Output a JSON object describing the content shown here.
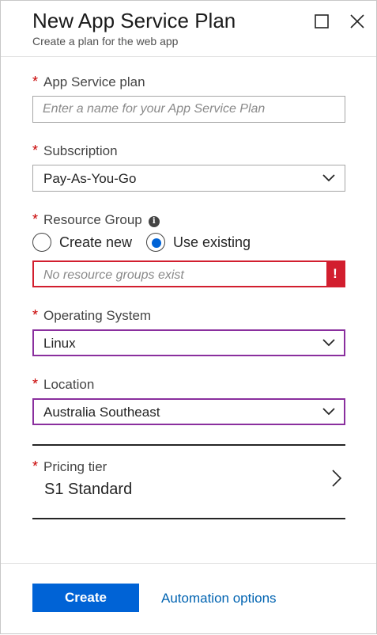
{
  "header": {
    "title": "New App Service Plan",
    "subtitle": "Create a plan for the web app"
  },
  "form": {
    "required_marker": "*",
    "app_service_plan": {
      "label": "App Service plan",
      "value": "",
      "placeholder": "Enter a name for your App Service Plan"
    },
    "subscription": {
      "label": "Subscription",
      "value": "Pay-As-You-Go"
    },
    "resource_group": {
      "label": "Resource Group",
      "info_icon": "i",
      "options": [
        {
          "label": "Create new",
          "selected": false
        },
        {
          "label": "Use existing",
          "selected": true
        }
      ],
      "placeholder": "No resource groups exist",
      "error_icon": "!"
    },
    "operating_system": {
      "label": "Operating System",
      "value": "Linux"
    },
    "location": {
      "label": "Location",
      "value": "Australia Southeast"
    },
    "pricing_tier": {
      "label": "Pricing tier",
      "value": "S1 Standard"
    }
  },
  "footer": {
    "create_label": "Create",
    "automation_label": "Automation options"
  },
  "colors": {
    "accent": "#0063d6",
    "error": "#d21e2e",
    "focus_border": "#8a2f9e",
    "required": "#c80000"
  }
}
